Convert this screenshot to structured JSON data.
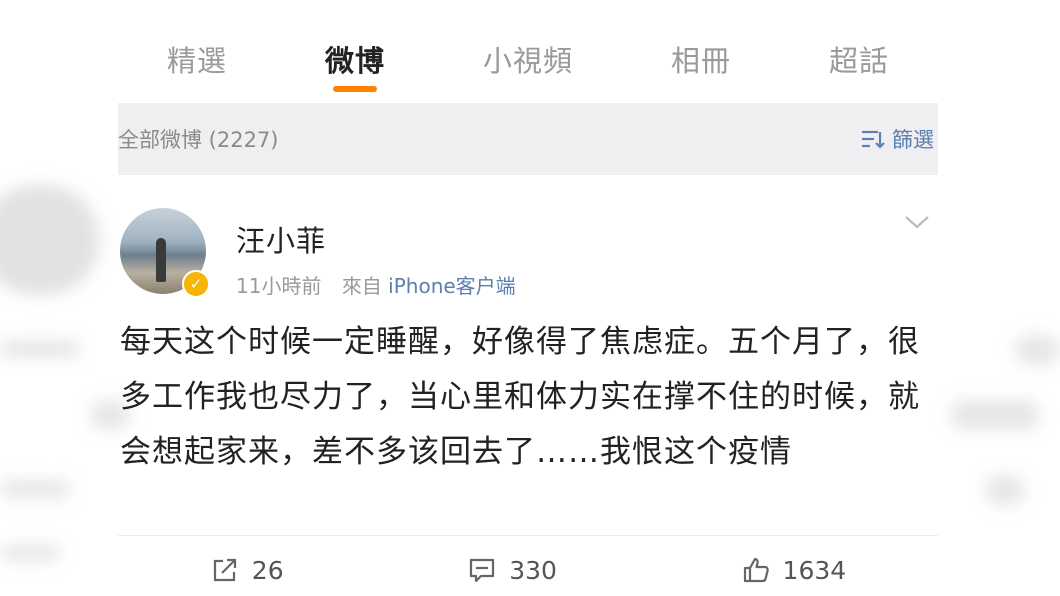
{
  "tabs": [
    {
      "label": "精選",
      "active": false
    },
    {
      "label": "微博",
      "active": true
    },
    {
      "label": "小視頻",
      "active": false
    },
    {
      "label": "相冊",
      "active": false
    },
    {
      "label": "超話",
      "active": false
    }
  ],
  "filter_bar": {
    "all_label": "全部微博 (2227)",
    "filter_label": "篩選",
    "filter_icon": "filter-icon"
  },
  "post": {
    "username": "汪小菲",
    "time": "11小時前",
    "source_prefix": "來自",
    "source_client": "iPhone客户端",
    "verified_icon": "verified-badge-icon",
    "menu_icon": "chevron-down-icon",
    "content": "每天这个时候一定睡醒，好像得了焦虑症。五个月了，很多工作我也尽力了，当心里和体力实在撑不住的时候，就会想起家来，差不多该回去了……我恨这个疫情",
    "repost_count": "26",
    "comment_count": "330",
    "like_count": "1634"
  },
  "colors": {
    "accent": "#ff8200",
    "link": "#5b7fae",
    "filter_bar_bg": "#efeff2"
  }
}
